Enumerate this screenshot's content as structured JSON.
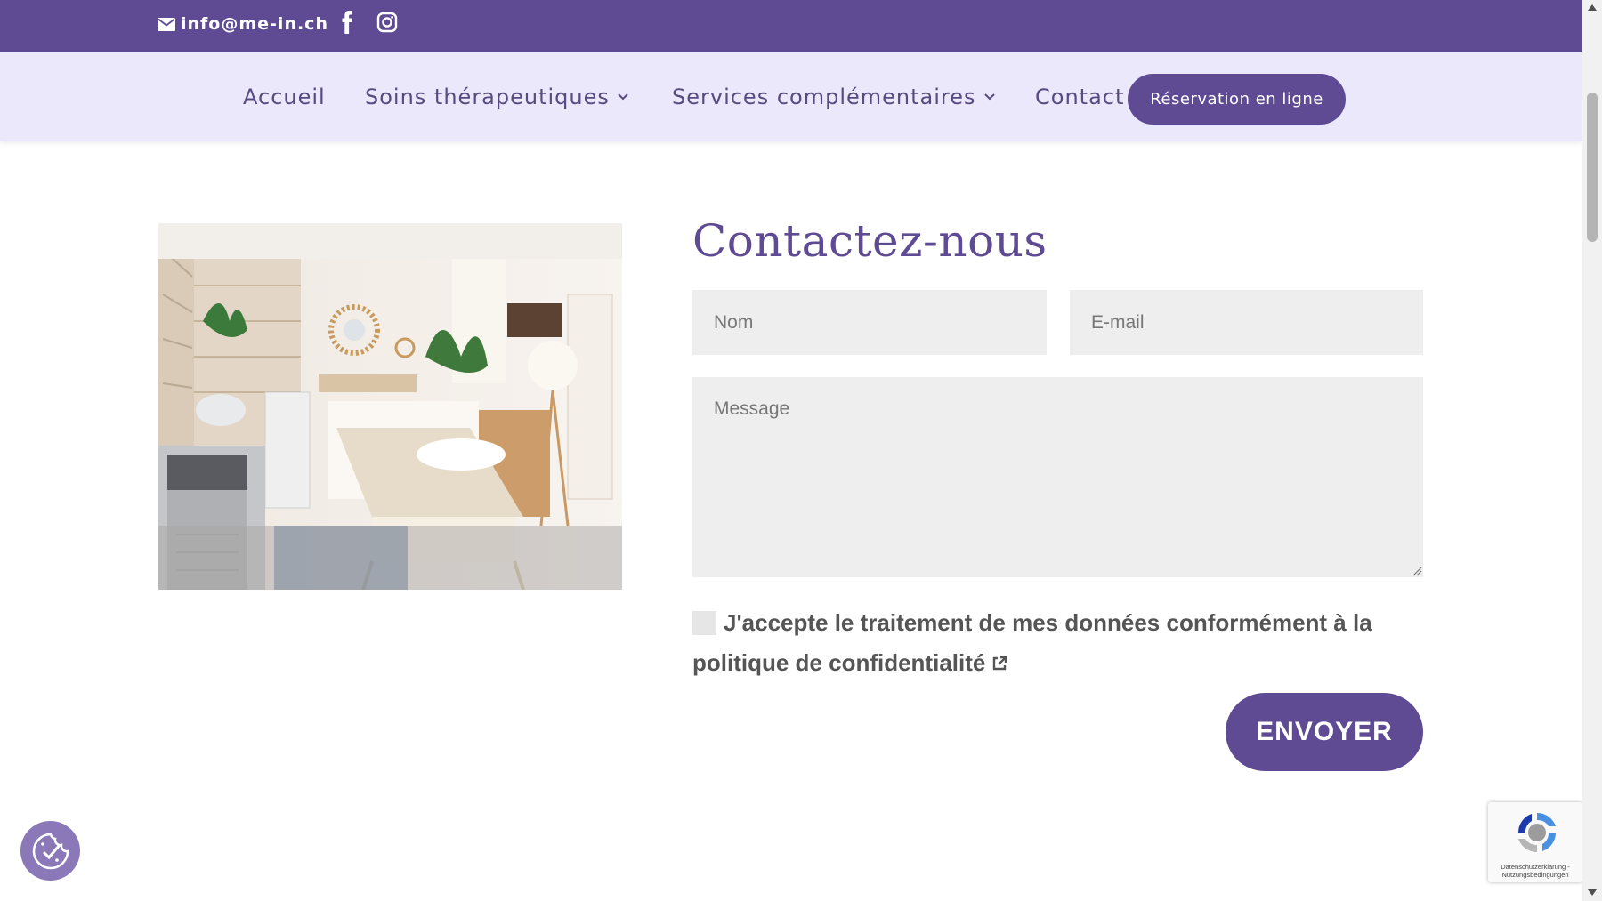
{
  "topbar": {
    "email": "info@me-in.ch",
    "icons": [
      "envelope-icon",
      "facebook-icon",
      "instagram-icon"
    ],
    "bg_color": "#5e4b93"
  },
  "nav": {
    "items": [
      {
        "label": "Accueil",
        "dropdown": false
      },
      {
        "label": "Soins thérapeutiques",
        "dropdown": true
      },
      {
        "label": "Services complémentaires",
        "dropdown": true
      },
      {
        "label": "Contact",
        "dropdown": false
      }
    ],
    "cta": "Réservation en ligne",
    "bg_color": "#ece8fc"
  },
  "contact": {
    "title": "Contactez-nous",
    "name_placeholder": "Nom",
    "email_placeholder": "E-mail",
    "message_placeholder": "Message",
    "consent_text": "J'accepte le traitement de mes données conformément à la politique de confidentialité",
    "submit_label": "ENVOYER"
  },
  "recaptcha": {
    "terms": "Datenschutzerklärung - Nutzungsbedingungen"
  },
  "colors": {
    "accent": "#5e4b93",
    "field_bg": "#eeeeee"
  }
}
